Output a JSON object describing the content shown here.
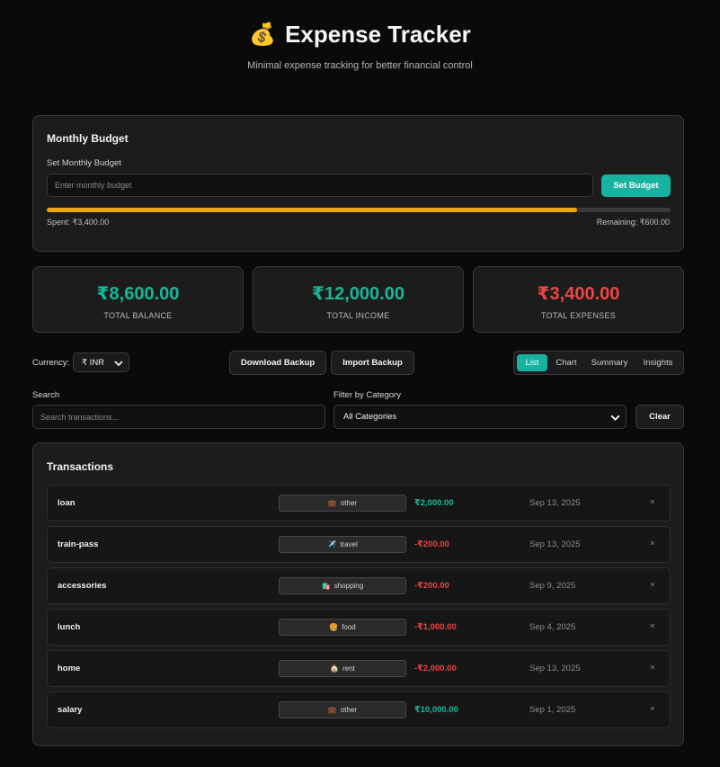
{
  "header": {
    "icon": "money-bag-icon",
    "emoji": "💰",
    "title": "Expense Tracker",
    "subtitle": "Minimal expense tracking for better financial control"
  },
  "budget": {
    "heading": "Monthly Budget",
    "label": "Set Monthly Budget",
    "placeholder": "Enter monthly budget",
    "button": "Set Budget",
    "progress_fraction": 0.85,
    "spent": "Spent: ₹3,400.00",
    "remaining": "Remaining: ₹600.00"
  },
  "stats": [
    {
      "value": "₹8,600.00",
      "label": "TOTAL BALANCE",
      "color": "#16b89a"
    },
    {
      "value": "₹12,000.00",
      "label": "TOTAL INCOME",
      "color": "#16b89a"
    },
    {
      "value": "₹3,400.00",
      "label": "TOTAL EXPENSES",
      "color": "#ef4444"
    }
  ],
  "toolbar": {
    "currency_label": "Currency:",
    "currency_value": "₹ INR",
    "download": "Download Backup",
    "import": "Import Backup",
    "tabs": [
      "List",
      "Chart",
      "Summary",
      "Insights"
    ],
    "active_tab": "List"
  },
  "filters": {
    "search_label": "Search",
    "search_placeholder": "Search transactions...",
    "category_label": "Filter by Category",
    "category_value": "All Categories",
    "clear": "Clear"
  },
  "transactions": {
    "heading": "Transactions",
    "items": [
      {
        "name": "loan",
        "category": "other",
        "emoji": "💼",
        "amount": "₹2,000.00",
        "type": "income",
        "date": "Sep 13, 2025",
        "delete": "×"
      },
      {
        "name": "train-pass",
        "category": "travel",
        "emoji": "✈️",
        "amount": "-₹200.00",
        "type": "expense",
        "date": "Sep 13, 2025",
        "delete": "×"
      },
      {
        "name": "accessories",
        "category": "shopping",
        "emoji": "🛍️",
        "amount": "-₹200.00",
        "type": "expense",
        "date": "Sep 9, 2025",
        "delete": "×"
      },
      {
        "name": "lunch",
        "category": "food",
        "emoji": "🍔",
        "amount": "-₹1,000.00",
        "type": "expense",
        "date": "Sep 4, 2025",
        "delete": "×"
      },
      {
        "name": "home",
        "category": "rent",
        "emoji": "🏠",
        "amount": "-₹2,000.00",
        "type": "expense",
        "date": "Sep 13, 2025",
        "delete": "×"
      },
      {
        "name": "salary",
        "category": "other",
        "emoji": "💼",
        "amount": "₹10,000.00",
        "type": "income",
        "date": "Sep 1, 2025",
        "delete": "×"
      }
    ]
  },
  "colors": {
    "accent": "#17b3a0",
    "income": "#16b89a",
    "expense": "#ef4444",
    "progress": "#f0a512"
  }
}
